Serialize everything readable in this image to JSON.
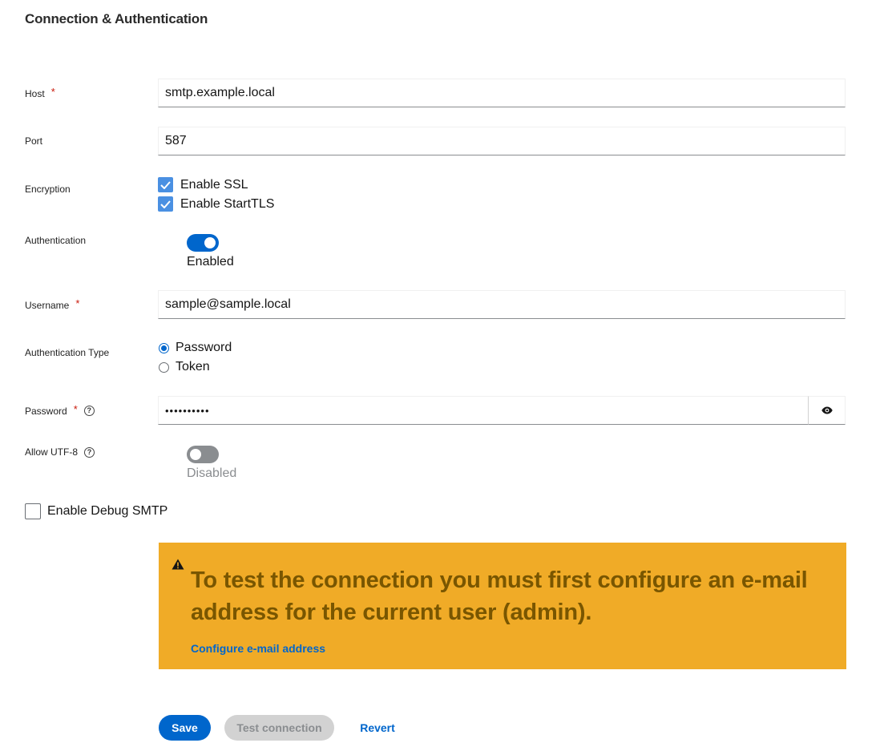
{
  "section": {
    "title": "Connection & Authentication"
  },
  "fields": {
    "host": {
      "label": "Host",
      "required_mark": "*",
      "value": "smtp.example.local"
    },
    "port": {
      "label": "Port",
      "value": "587"
    },
    "encryption": {
      "label": "Encryption",
      "ssl": {
        "label": "Enable SSL",
        "checked": true
      },
      "starttls": {
        "label": "Enable StartTLS",
        "checked": true
      }
    },
    "authentication": {
      "label": "Authentication",
      "state": "Enabled",
      "on": true
    },
    "username": {
      "label": "Username",
      "required_mark": "*",
      "value": "sample@sample.local"
    },
    "auth_type": {
      "label": "Authentication Type",
      "options": [
        {
          "label": "Password",
          "selected": true
        },
        {
          "label": "Token",
          "selected": false
        }
      ]
    },
    "password": {
      "label": "Password",
      "required_mark": "*",
      "help": "?",
      "value": "••••••••••"
    },
    "utf8": {
      "label": "Allow UTF-8",
      "help": "?",
      "state": "Disabled",
      "on": false
    },
    "debug": {
      "label": "Enable Debug SMTP",
      "checked": false
    }
  },
  "alert": {
    "icon": "warning-triangle-icon",
    "title": "To test the connection you must first configure an e-mail address for the current user (admin).",
    "link": "Configure e-mail address",
    "color": "#f0ab27",
    "text_color": "#795600"
  },
  "actions": {
    "save": "Save",
    "test": "Test connection",
    "revert": "Revert"
  },
  "colors": {
    "primary": "#0066cc",
    "checkbox": "#4a90e2",
    "required": "#c9190b",
    "switch_off": "#8a8d90"
  }
}
